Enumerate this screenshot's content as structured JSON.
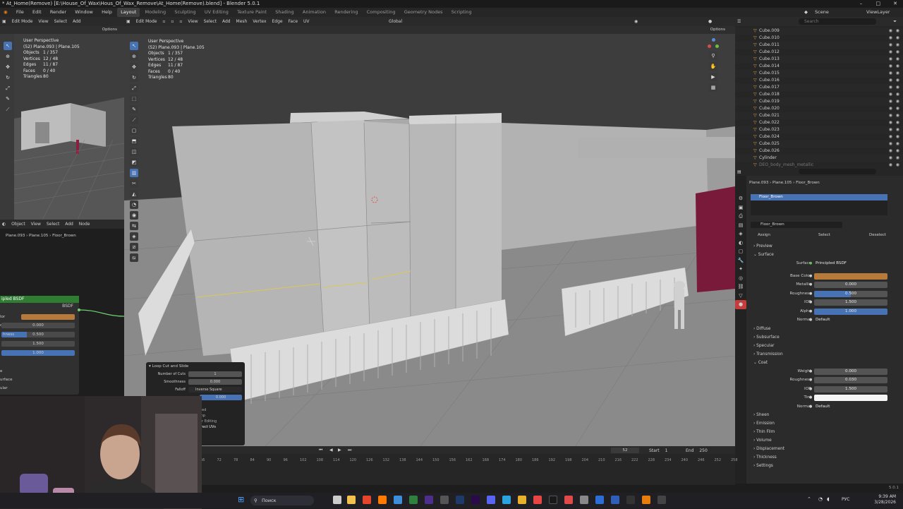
{
  "window_title": "* At_Home(Remove) [E:\\House_Of_Wax\\Hous_Of_Wax_Remove\\At_Home(Remove).blend] - Blender 5.0.1",
  "window_controls": [
    "–",
    "□",
    "✕"
  ],
  "menu": [
    "File",
    "Edit",
    "Render",
    "Window",
    "Help"
  ],
  "workspaces": [
    "Layout",
    "Modeling",
    "Sculpting",
    "UV Editing",
    "Texture Paint",
    "Shading",
    "Animation",
    "Rendering",
    "Compositing",
    "Geometry Nodes",
    "Scripting"
  ],
  "active_workspace": "Layout",
  "scene_label": "Scene",
  "viewlayer_label": "ViewLayer",
  "left_viewport": {
    "mode": "Edit Mode",
    "menus": [
      "View",
      "Select",
      "Add"
    ],
    "options": "Options",
    "perspective": "User Perspective",
    "object_line": "(52) Plane.093 | Plane.105",
    "stats": [
      {
        "label": "Objects",
        "value": "1 / 357"
      },
      {
        "label": "Vertices",
        "value": "12 / 48"
      },
      {
        "label": "Edges",
        "value": "11 / 87"
      },
      {
        "label": "Faces",
        "value": "0 / 40"
      },
      {
        "label": "Triangles",
        "value": "80"
      }
    ]
  },
  "main_viewport": {
    "mode": "Edit Mode",
    "menus": [
      "View",
      "Select",
      "Add",
      "Mesh",
      "Vertex",
      "Edge",
      "Face",
      "UV"
    ],
    "transform": "Global",
    "options": "Options",
    "perspective": "User Perspective",
    "object_line": "(52) Plane.093 | Plane.105",
    "stats": [
      {
        "label": "Objects",
        "value": "1 / 357"
      },
      {
        "label": "Vertices",
        "value": "12 / 48"
      },
      {
        "label": "Edges",
        "value": "11 / 87"
      },
      {
        "label": "Faces",
        "value": "0 / 40"
      },
      {
        "label": "Triangles",
        "value": "80"
      }
    ]
  },
  "node_editor": {
    "mode": "Object",
    "menus": [
      "View",
      "Select",
      "Add",
      "Node"
    ],
    "breadcrumb": [
      "Plane.093",
      "Plane.105",
      "Floor_Brown"
    ],
    "node_title": "ipled BSDF",
    "output": "BSDF",
    "fields": [
      {
        "label": "lor",
        "value": "",
        "kind": "color"
      },
      {
        "label": "c",
        "value": "0.000",
        "kind": "num"
      },
      {
        "label": "hness",
        "value": "0.500",
        "kind": "blue"
      },
      {
        "label": "",
        "value": "1.500",
        "kind": "num"
      },
      {
        "label": "",
        "value": "1.000",
        "kind": "blue"
      }
    ],
    "sections": [
      "e",
      "urface",
      "ular"
    ]
  },
  "operator_panel": {
    "title": "Loop Cut and Slide",
    "rows": [
      {
        "label": "Number of Cuts",
        "value": "1"
      },
      {
        "label": "Smoothness",
        "value": "0.000"
      },
      {
        "label": "Falloff",
        "value": "Inverse Square"
      },
      {
        "label": "",
        "value": "0.000"
      }
    ],
    "extra": [
      "p",
      "ped",
      "mp",
      "or Editing",
      "rrect UVs"
    ]
  },
  "outliner": {
    "search_placeholder": "Search",
    "items": [
      "Cube.009",
      "Cube.010",
      "Cube.011",
      "Cube.012",
      "Cube.013",
      "Cube.014",
      "Cube.015",
      "Cube.016",
      "Cube.017",
      "Cube.018",
      "Cube.019",
      "Cube.020",
      "Cube.021",
      "Cube.022",
      "Cube.023",
      "Cube.024",
      "Cube.025",
      "Cube.026",
      "Cylinder",
      "DEO_body_mesh_metallic"
    ]
  },
  "properties": {
    "breadcrumb": [
      "Plane.093",
      "Plane.105",
      "Floor_Brown"
    ],
    "slot": "Floor_Brown",
    "material_name": "Floor_Brown",
    "buttons": [
      "Assign",
      "Select",
      "Deselect"
    ],
    "sections_top": [
      "Preview",
      "Surface"
    ],
    "surface_shader_label": "Surface",
    "surface_shader": "Principled BSDF",
    "inputs": [
      {
        "label": "Base Color",
        "value": "",
        "kind": "color",
        "color": "#b77a3a"
      },
      {
        "label": "Metallic",
        "value": "0.000",
        "kind": "num"
      },
      {
        "label": "Roughness",
        "value": "0.500",
        "kind": "blue"
      },
      {
        "label": "IOR",
        "value": "1.500",
        "kind": "num"
      },
      {
        "label": "Alpha",
        "value": "1.000",
        "kind": "blue"
      },
      {
        "label": "Normal",
        "value": "Default",
        "kind": "text"
      }
    ],
    "subsections": [
      "Diffuse",
      "Subsurface",
      "Specular",
      "Transmission",
      "Coat"
    ],
    "coat_inputs": [
      {
        "label": "Weight",
        "value": "0.000",
        "kind": "num"
      },
      {
        "label": "Roughness",
        "value": "0.030",
        "kind": "num"
      },
      {
        "label": "IOR",
        "value": "1.500",
        "kind": "num"
      },
      {
        "label": "Tint",
        "value": "",
        "kind": "white"
      },
      {
        "label": "Normal",
        "value": "Default",
        "kind": "text"
      }
    ],
    "sections_bottom": [
      "Sheen",
      "Emission",
      "Thin Film",
      "Volume",
      "Displacement",
      "Thickness",
      "Settings"
    ]
  },
  "timeline": {
    "current_frame": "52",
    "start_label": "Start",
    "start": "1",
    "end_label": "End",
    "end": "250",
    "ticks": [
      "66",
      "72",
      "78",
      "84",
      "90",
      "96",
      "102",
      "108",
      "114",
      "120",
      "126",
      "132",
      "138",
      "144",
      "150",
      "156",
      "162",
      "168",
      "174",
      "180",
      "186",
      "192",
      "198",
      "204",
      "210",
      "216",
      "222",
      "228",
      "234",
      "240",
      "246",
      "252",
      "258"
    ]
  },
  "status_version": "5.0.1",
  "taskbar": {
    "search_label": "Поиск",
    "lang": "РУС",
    "time": "9:39 AM",
    "date": "3/28/2026"
  }
}
